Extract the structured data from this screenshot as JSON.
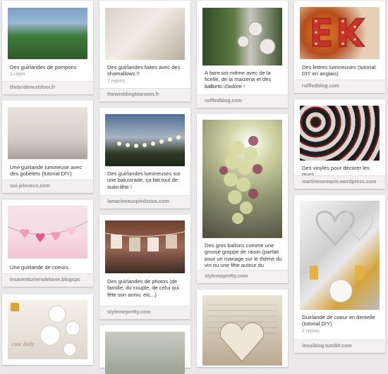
{
  "pins": [
    {
      "id": "p1",
      "description": "Des guirlandes de pompons",
      "meta": "1 repin",
      "source": "thebridenextdoor.fr"
    },
    {
      "id": "p2",
      "description": "Des guirlandes faites avec des shamallows !!",
      "meta": "2 repins",
      "source": "theweddingtearoom.fr"
    },
    {
      "id": "p3",
      "description": "A faire soi-même avec de la ficelle, de la maïzena et des ballons. J'adore !",
      "meta": "1 like   1 repin",
      "source": "ruffledblog.com"
    },
    {
      "id": "p4",
      "description": "Des lettres lumineuses (tutorial DIY en anglais)",
      "meta": "",
      "source": "ruffledblog.com"
    },
    {
      "id": "p5",
      "description": "Une guirlande lumineuse avec des gobelets (tutorial DIY)",
      "meta": "",
      "source": "oui-jeleveux.com"
    },
    {
      "id": "p6",
      "description": "Des guirlandes lumineuses sur une balustrade, ça fait tout de suite fête !",
      "meta": "1 repin",
      "source": "lamarieeauxpiedsnus.com"
    },
    {
      "id": "p7",
      "description": "Des gros ballons comme une grosse grappe de raisin (parfait pour un mariage sur le thème du vin ou une fête autour du Beaujolais nouveau ! :)",
      "meta": "",
      "source": "stylemepretty.com"
    },
    {
      "id": "p8",
      "description": "Des vinyles pour décorer les murs.",
      "meta": "",
      "source": "martinesemarie.wordpress.com"
    },
    {
      "id": "p9",
      "description": "Une guirlande de coeurs.",
      "meta": "",
      "source": "lesaventuriersdelavie.blogspc"
    },
    {
      "id": "p10",
      "description": "Des guirlandes de photos (de famille, du couple, de celui qui fête son anniv, etc...)",
      "meta": "",
      "source": "stylemepretty.com"
    },
    {
      "id": "p11",
      "description": "Guirlande de coeur en dentelle (tutorial DIY)",
      "meta": "2 repins",
      "source": "leouiblog.tumblr.com"
    }
  ],
  "images": {
    "p12_overlay": "cute daily"
  }
}
